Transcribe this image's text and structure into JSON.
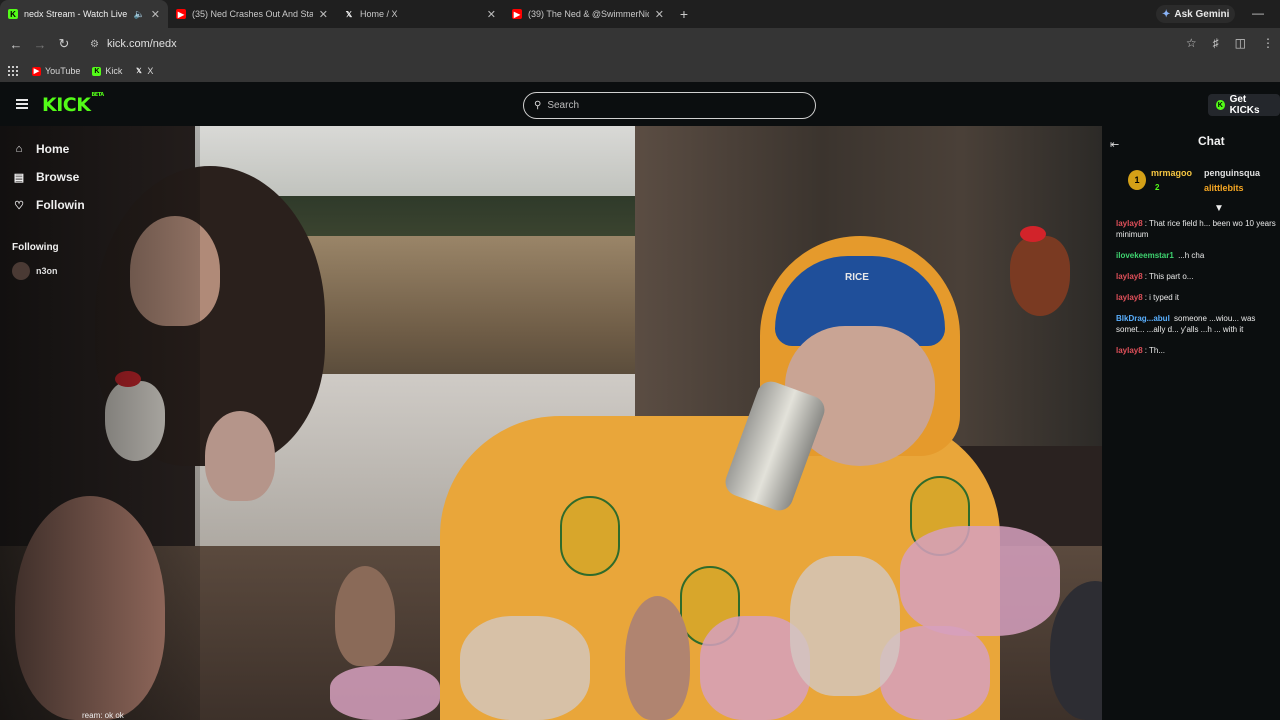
{
  "browser": {
    "tabs": [
      {
        "title": "nedx Stream - Watch Live o",
        "icon": "kick-favicon",
        "active": true,
        "color": "#53fc18"
      },
      {
        "title": "(35) Ned Crashes Out And Star",
        "icon": "youtube-favicon",
        "active": false,
        "color": "#ff0000"
      },
      {
        "title": "Home / X",
        "icon": "x-favicon",
        "active": false,
        "color": "#ffffff"
      },
      {
        "title": "(39) The Ned & @SwimmerNic",
        "icon": "youtube-favicon",
        "active": false,
        "color": "#ff0000"
      }
    ],
    "new_tab_label": "+",
    "ask_gemini_label": "Ask Gemini",
    "url": "kick.com/nedx",
    "bookmarks": [
      {
        "label": "YouTube",
        "icon": "youtube-favicon",
        "color": "#ff0000"
      },
      {
        "label": "Kick",
        "icon": "kick-favicon",
        "color": "#53fc18"
      },
      {
        "label": "X",
        "icon": "x-favicon",
        "color": "#ffffff"
      }
    ]
  },
  "kick": {
    "logo_text": "KICK",
    "logo_badge": "BETA",
    "search_placeholder": "Search",
    "get_kicks_label": "Get KICKs",
    "accent_color": "#53fc18"
  },
  "sidebar": {
    "items": [
      {
        "label": "Home",
        "icon": "home-icon"
      },
      {
        "label": "Browse",
        "icon": "browse-icon"
      },
      {
        "label": "Followin",
        "icon": "heart-icon"
      }
    ],
    "following_header": "Following",
    "following": [
      {
        "name": "n3on"
      }
    ]
  },
  "video": {
    "cap_text": "RICE",
    "overlay_caption": "ream: ok ok"
  },
  "chat": {
    "title": "Chat",
    "top_gifters": [
      {
        "rank": "1",
        "name": "mrmagoo",
        "count": "2"
      },
      {
        "name": "penguinsqua"
      },
      {
        "name": "alittlebits"
      }
    ],
    "messages": [
      {
        "user": "laylay8",
        "user_class": "u-red",
        "text": "That rice field h... been wo 10 years minimum"
      },
      {
        "user": "ilovekeemstar1",
        "user_class": "u-green",
        "text": "...h cha"
      },
      {
        "user": "laylay8",
        "user_class": "u-red",
        "text": "This part o..."
      },
      {
        "user": "laylay8",
        "user_class": "u-red",
        "text": "i typed it"
      },
      {
        "user": "BlkDrag...abul",
        "user_class": "u-blue",
        "text": "someone ...wiou... was somet... ...ally d... y'alls ...h ... with it"
      },
      {
        "user": "laylay8",
        "user_class": "u-red",
        "text": "Th..."
      }
    ]
  }
}
